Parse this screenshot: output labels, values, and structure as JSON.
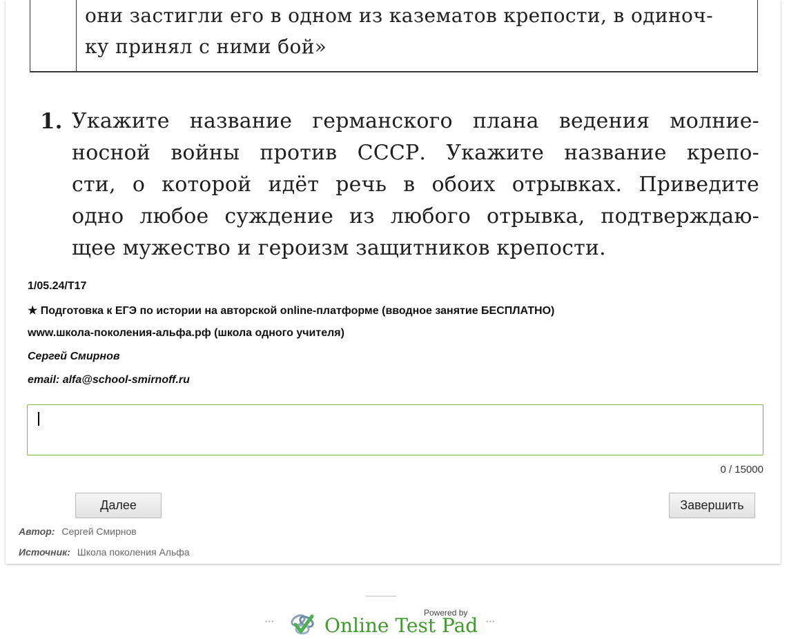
{
  "scan": {
    "quote_lines": [
      "они застигли его в одном из казематов крепости, в одиноч-",
      "ку принял с ними бой»"
    ],
    "question_number": "1.",
    "question_lines": [
      "Укажите название германского плана ведения молние-",
      "носной войны против СССР. Укажите название крепо-",
      "сти, о которой идёт речь в обоих отрывках. Приведите",
      "одно любое суждение из любого отрывка, подтверждаю-",
      "щее мужество и героизм защитников крепости."
    ]
  },
  "info": {
    "code": "1/05.24/Т17",
    "promo": "★ Подготовка к ЕГЭ по истории на авторской online-платформе (вводное занятие БЕСПЛАТНО)",
    "site": "www.школа-поколения-альфа.рф (школа одного учителя)",
    "name": "Сергей Смирнов",
    "email": "email: alfa@school-smirnoff.ru"
  },
  "answer": {
    "value": "",
    "counter": "0 / 15000"
  },
  "buttons": {
    "next": "Далее",
    "finish": "Завершить"
  },
  "meta": {
    "author_label": "Автор:",
    "author_value": "Сергей Смирнов",
    "source_label": "Источник:",
    "source_value": "Школа поколения Альфа"
  },
  "footer": {
    "powered_by": "Powered by",
    "brand": "Online Test Pad",
    "dots": "•••",
    "logo_icon": "check-shield-icon",
    "brand_color": "#3f9a2c"
  }
}
